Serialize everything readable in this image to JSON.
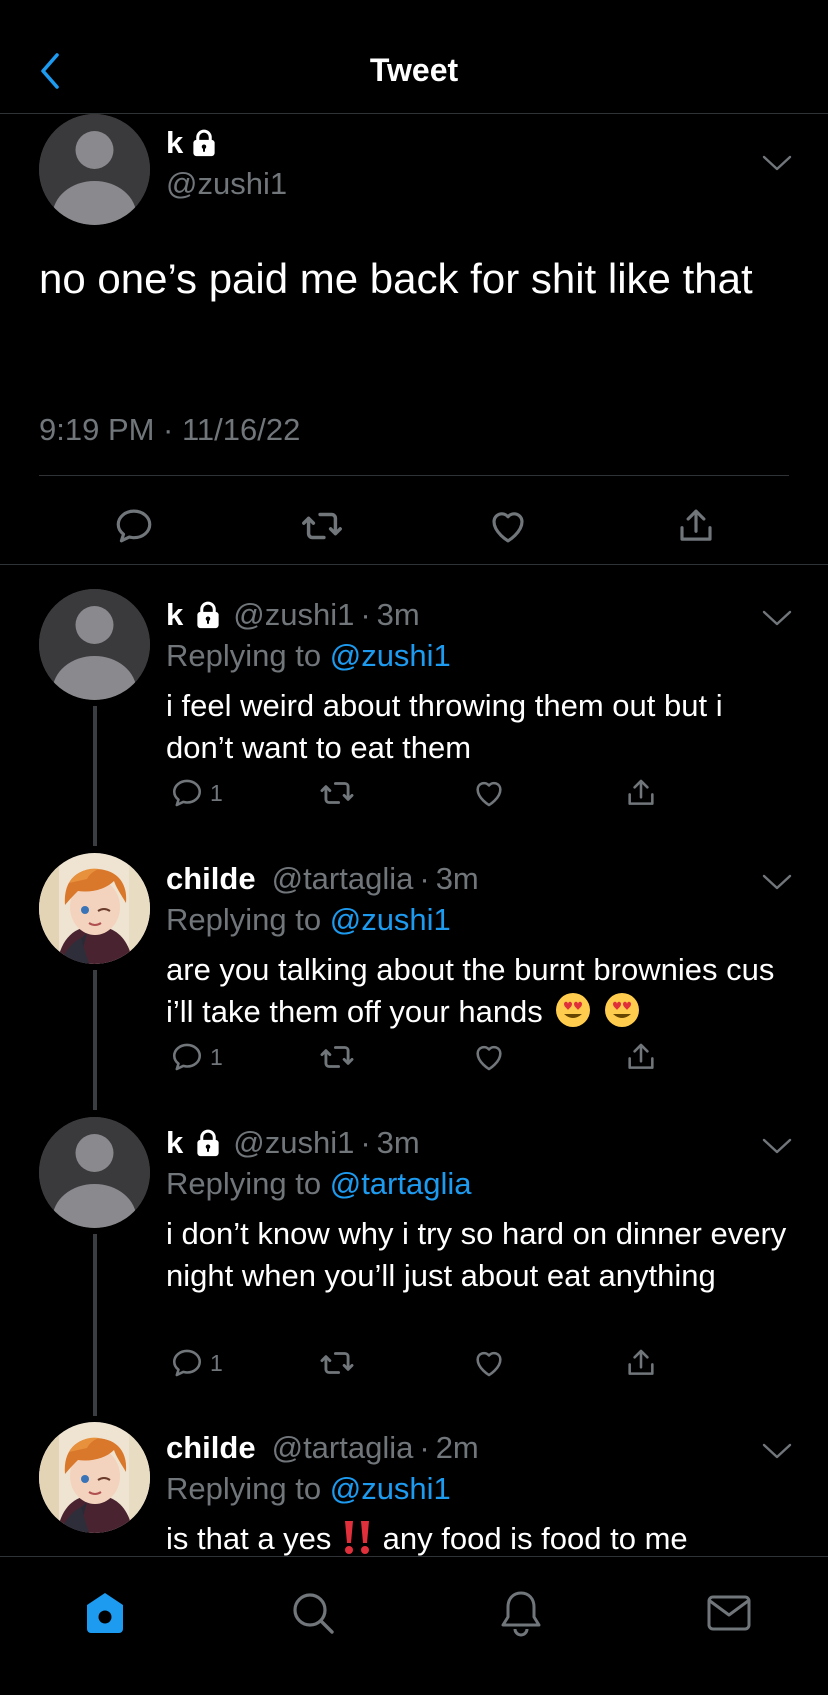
{
  "header": {
    "title": "Tweet"
  },
  "main_tweet": {
    "name": "k",
    "handle": "@zushi1",
    "text": "no one’s paid me back for shit like that",
    "timestamp": "9:19 PM · 11/16/22"
  },
  "replies": [
    {
      "name": "k",
      "handle": "@zushi1",
      "time": "3m",
      "replying_prefix": "Replying to ",
      "replying_to": "@zushi1",
      "text": "i feel weird about throwing them out but i don’t want to eat them",
      "reply_count": "1"
    },
    {
      "name": "childe",
      "handle": "@tartaglia",
      "time": "3m",
      "replying_prefix": "Replying to ",
      "replying_to": "@zushi1",
      "text": "are you talking about the burnt brownies cus i’ll take them off your hands",
      "reply_count": "1"
    },
    {
      "name": "k",
      "handle": "@zushi1",
      "time": "3m",
      "replying_prefix": "Replying to ",
      "replying_to": "@tartaglia",
      "text": "i don’t know why i try so hard on dinner every night when you’ll just about eat anything",
      "reply_count": "1"
    },
    {
      "name": "childe",
      "handle": "@tartaglia",
      "time": "2m",
      "replying_prefix": "Replying to ",
      "replying_to": "@zushi1",
      "text_before": "is that a yes ",
      "text_after": " any food is food to me"
    }
  ],
  "separator": "·",
  "colors": {
    "accent": "#1d9bf0",
    "muted": "#71767b",
    "background": "#000000",
    "divider": "#2f3336"
  },
  "icons": {
    "back": "chevron-left-icon",
    "lock": "lock-icon",
    "menu": "chevron-down-icon",
    "reply": "reply-icon",
    "retweet": "retweet-icon",
    "like": "heart-icon",
    "share": "share-icon",
    "home": "home-icon",
    "search": "search-icon",
    "notifications": "bell-icon",
    "messages": "mail-icon"
  }
}
